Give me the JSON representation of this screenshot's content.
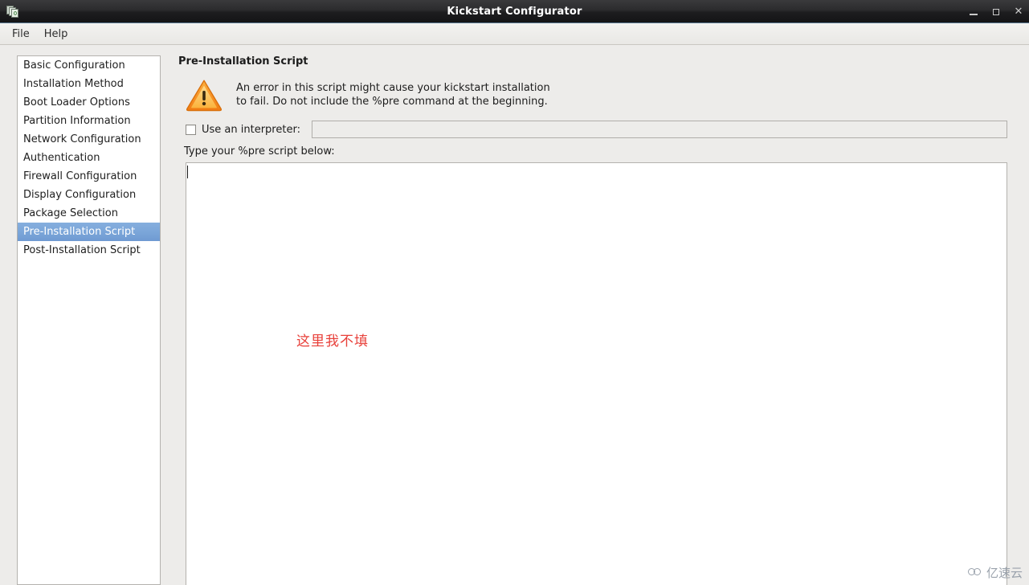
{
  "window": {
    "title": "Kickstart Configurator",
    "icon": "app-stack-icon",
    "controls": {
      "minimize": "–",
      "maximize": "□",
      "close": "✕"
    }
  },
  "menubar": {
    "items": [
      {
        "label": "File"
      },
      {
        "label": "Help"
      }
    ]
  },
  "sidebar": {
    "items": [
      {
        "label": "Basic Configuration",
        "selected": false
      },
      {
        "label": "Installation Method",
        "selected": false
      },
      {
        "label": "Boot Loader Options",
        "selected": false
      },
      {
        "label": "Partition Information",
        "selected": false
      },
      {
        "label": "Network Configuration",
        "selected": false
      },
      {
        "label": "Authentication",
        "selected": false
      },
      {
        "label": "Firewall Configuration",
        "selected": false
      },
      {
        "label": "Display Configuration",
        "selected": false
      },
      {
        "label": "Package Selection",
        "selected": false
      },
      {
        "label": "Pre-Installation Script",
        "selected": true
      },
      {
        "label": "Post-Installation Script",
        "selected": false
      }
    ]
  },
  "main": {
    "title": "Pre-Installation Script",
    "warning": {
      "icon": "warning-triangle-icon",
      "line1": "An error in this script might cause your kickstart installation",
      "line2": "to fail. Do not include the %pre command at the beginning.",
      "color": "#f18b1f"
    },
    "interpreter": {
      "checkbox_label": "Use an interpreter:",
      "checked": false,
      "value": "",
      "placeholder": ""
    },
    "script": {
      "label": "Type your %pre script below:",
      "content": "",
      "note": "这里我不填",
      "note_color": "#e8403a"
    }
  },
  "watermark": {
    "text": "亿速云",
    "color": "#9aa2ac"
  }
}
